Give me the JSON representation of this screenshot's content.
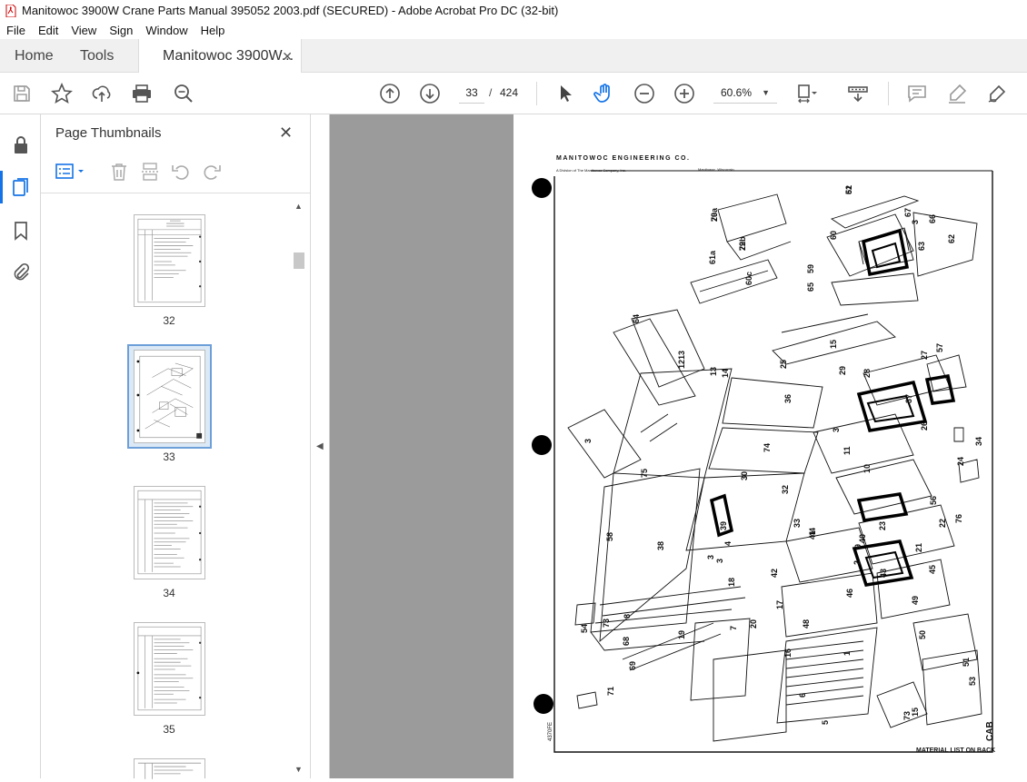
{
  "window": {
    "title": "Manitowoc 3900W Crane Parts Manual 395052 2003.pdf (SECURED) - Adobe Acrobat Pro DC (32-bit)"
  },
  "menu": [
    "File",
    "Edit",
    "View",
    "Sign",
    "Window",
    "Help"
  ],
  "tabs": {
    "home": "Home",
    "tools": "Tools",
    "document": "Manitowoc 3900W..."
  },
  "toolbar": {
    "current_page": "33",
    "separator": "/",
    "total_pages": "424",
    "zoom": "60.6%"
  },
  "thumbnails_panel": {
    "title": "Page Thumbnails",
    "pages": [
      "32",
      "33",
      "34",
      "35"
    ],
    "selected_page": "33"
  },
  "document_page": {
    "header": "MANITOWOC ENGINEERING CO.",
    "subheader_left": "A Division of The Manitowoc Company, Inc.",
    "subheader_right": "Manitowoc, Wisconsin",
    "footer": "MATERIAL LIST ON BACK",
    "side_label": "CAB",
    "drawing_number": "4370FE",
    "part_numbers": [
      "61",
      "29a",
      "29b",
      "61a",
      "60c",
      "60",
      "67",
      "3",
      "66",
      "63",
      "62",
      "59",
      "65",
      "64",
      "13",
      "12",
      "13",
      "14",
      "15",
      "25",
      "29",
      "28",
      "27",
      "57",
      "36",
      "37",
      "26",
      "3",
      "34",
      "3",
      "75",
      "74",
      "11",
      "10",
      "24",
      "30",
      "32",
      "33",
      "56",
      "23",
      "22",
      "76",
      "58",
      "38",
      "39",
      "3",
      "40",
      "41",
      "9",
      "21",
      "3",
      "4",
      "2",
      "45",
      "44",
      "43",
      "42",
      "46",
      "18",
      "17",
      "48",
      "49",
      "50",
      "54",
      "73",
      "8",
      "7",
      "20",
      "19",
      "16",
      "1",
      "51",
      "53",
      "68",
      "69",
      "71",
      "6",
      "5",
      "73",
      "15",
      "52",
      "70",
      "72"
    ]
  },
  "colors": {
    "accent": "#1473e6",
    "viewer_bg": "#9b9b9b",
    "selection": "#dbe8f6"
  }
}
